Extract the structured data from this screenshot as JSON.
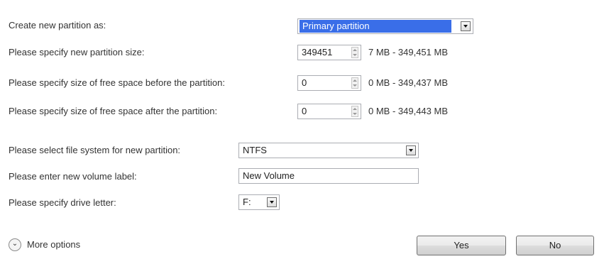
{
  "form": {
    "create_as_label": "Create new partition as:",
    "partition_type_value": "Primary partition",
    "size_label": "Please specify new partition size:",
    "size_value": "349451",
    "size_range": "7 MB - 349,451 MB",
    "before_label": "Please specify size of free space before the partition:",
    "before_value": "0",
    "before_range": "0 MB - 349,437 MB",
    "after_label": "Please specify size of free space after the partition:",
    "after_value": "0",
    "after_range": "0 MB - 349,443 MB",
    "fs_label": "Please select file system for new partition:",
    "fs_value": "NTFS",
    "volume_label_label": "Please enter new volume label:",
    "volume_label_value": "New Volume",
    "drive_letter_label": "Please specify drive letter:",
    "drive_letter_value": "F:"
  },
  "footer": {
    "more_options_label": "More options",
    "yes_label": "Yes",
    "no_label": "No"
  },
  "icons": {
    "more_options": "double-chevron-down-icon",
    "dropdown": "dropdown-arrow-icon",
    "spinner": "spinner-arrows-icon"
  },
  "colors": {
    "selection_highlight": "#3a6ee8",
    "selection_text": "#ffffff"
  }
}
